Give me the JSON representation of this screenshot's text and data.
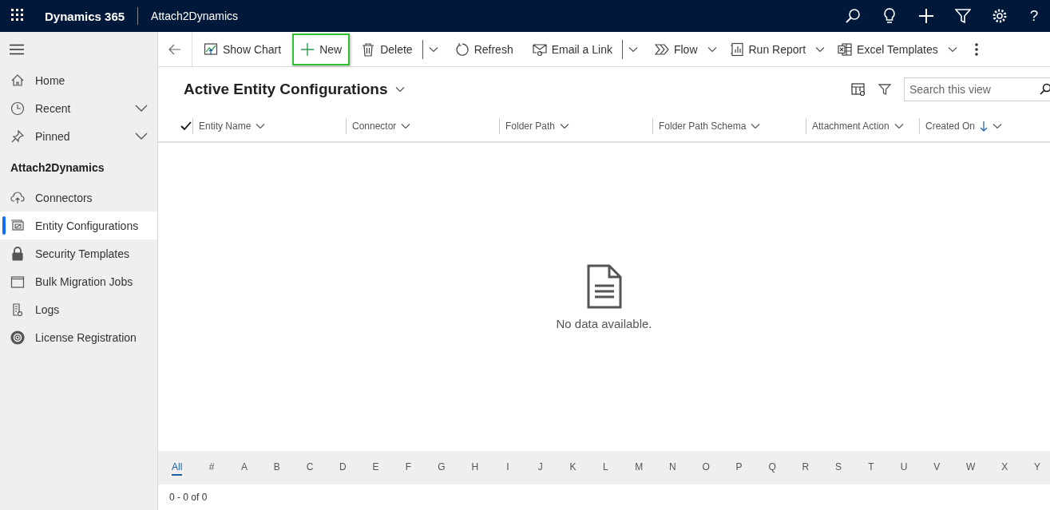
{
  "top_bar": {
    "app_name": "Dynamics 365",
    "area": "Attach2Dynamics",
    "help_glyph": "?"
  },
  "sidebar": {
    "nav": [
      {
        "label": "Home",
        "kind": "link"
      },
      {
        "label": "Recent",
        "kind": "expander",
        "expanded": false
      },
      {
        "label": "Pinned",
        "kind": "expander",
        "expanded": false
      }
    ],
    "group_title": "Attach2Dynamics",
    "items": [
      {
        "label": "Connectors",
        "selected": false
      },
      {
        "label": "Entity Configurations",
        "selected": true
      },
      {
        "label": "Security Templates",
        "selected": false
      },
      {
        "label": "Bulk Migration Jobs",
        "selected": false
      },
      {
        "label": "Logs",
        "selected": false
      },
      {
        "label": "License Registration",
        "selected": false
      }
    ]
  },
  "command_bar": {
    "buttons": [
      {
        "label": "Show Chart",
        "kind": "button",
        "highlighted": false
      },
      {
        "label": "New",
        "kind": "button",
        "highlighted": true
      },
      {
        "label": "Delete",
        "kind": "split",
        "highlighted": false
      },
      {
        "label": "Refresh",
        "kind": "button",
        "highlighted": false
      },
      {
        "label": "Email a Link",
        "kind": "split",
        "highlighted": false
      },
      {
        "label": "Flow",
        "kind": "dropdown",
        "highlighted": false
      },
      {
        "label": "Run Report",
        "kind": "dropdown",
        "highlighted": false
      },
      {
        "label": "Excel Templates",
        "kind": "dropdown",
        "highlighted": false
      }
    ]
  },
  "view": {
    "title": "Active Entity Configurations",
    "search": {
      "placeholder": "Search this view"
    }
  },
  "table": {
    "columns": [
      {
        "label": "Entity Name",
        "sorted_descending": false
      },
      {
        "label": "Connector",
        "sorted_descending": false
      },
      {
        "label": "Folder Path",
        "sorted_descending": false
      },
      {
        "label": "Folder Path Schema",
        "sorted_descending": false
      },
      {
        "label": "Attachment Action",
        "sorted_descending": false
      },
      {
        "label": "Created On",
        "sorted_descending": true
      }
    ],
    "empty_message": "No data available."
  },
  "alphabet_bar": [
    {
      "label": "All",
      "selected": true
    },
    {
      "label": "#",
      "selected": false
    },
    {
      "label": "A",
      "selected": false
    },
    {
      "label": "B",
      "selected": false
    },
    {
      "label": "C",
      "selected": false
    },
    {
      "label": "D",
      "selected": false
    },
    {
      "label": "E",
      "selected": false
    },
    {
      "label": "F",
      "selected": false
    },
    {
      "label": "G",
      "selected": false
    },
    {
      "label": "H",
      "selected": false
    },
    {
      "label": "I",
      "selected": false
    },
    {
      "label": "J",
      "selected": false
    },
    {
      "label": "K",
      "selected": false
    },
    {
      "label": "L",
      "selected": false
    },
    {
      "label": "M",
      "selected": false
    },
    {
      "label": "N",
      "selected": false
    },
    {
      "label": "O",
      "selected": false
    },
    {
      "label": "P",
      "selected": false
    },
    {
      "label": "Q",
      "selected": false
    },
    {
      "label": "R",
      "selected": false
    },
    {
      "label": "S",
      "selected": false
    },
    {
      "label": "T",
      "selected": false
    },
    {
      "label": "U",
      "selected": false
    },
    {
      "label": "V",
      "selected": false
    },
    {
      "label": "W",
      "selected": false
    },
    {
      "label": "X",
      "selected": false
    },
    {
      "label": "Y",
      "selected": false
    }
  ],
  "footer": {
    "record_count": "0 - 0 of 0"
  }
}
